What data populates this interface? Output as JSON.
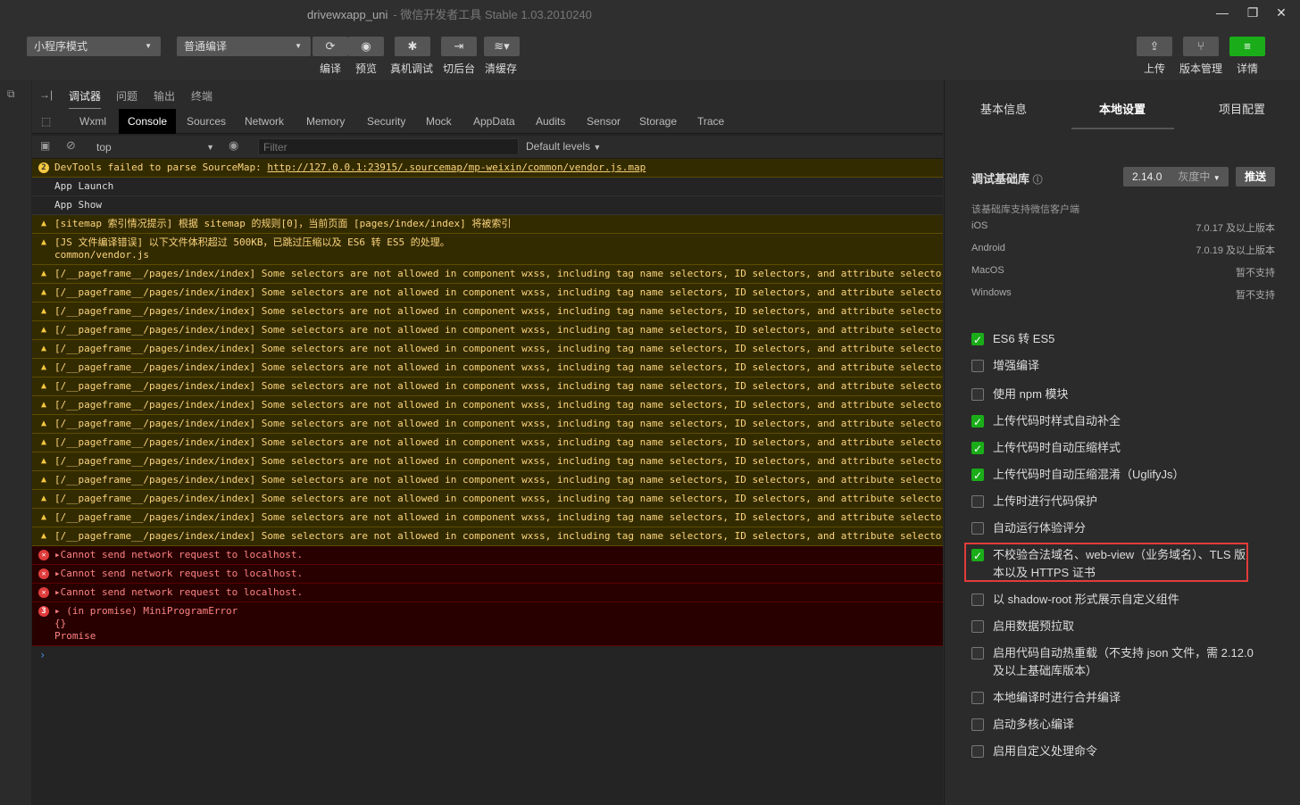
{
  "window": {
    "title": "drivewxapp_uni",
    "subtitle": "- 微信开发者工具 Stable 1.03.2010240",
    "minimize_icon": "minimize-icon",
    "restore_icon": "restore-icon",
    "close_icon": "close-icon"
  },
  "toolbar": {
    "mode_select": "小程序模式",
    "compile_select": "普通编译",
    "buttons": [
      {
        "label": "编译",
        "icon": "refresh-icon"
      },
      {
        "label": "预览",
        "icon": "eye-icon"
      },
      {
        "label": "真机调试",
        "icon": "bug-icon"
      },
      {
        "label": "切后台",
        "icon": "switch-icon"
      },
      {
        "label": "清缓存",
        "icon": "layers-icon"
      }
    ],
    "right_buttons": [
      {
        "label": "上传",
        "icon": "upload-icon"
      },
      {
        "label": "版本管理",
        "icon": "branch-icon"
      },
      {
        "label": "详情",
        "icon": "menu-icon"
      }
    ],
    "accent": "#1aad19"
  },
  "devtools": {
    "top_tabs": [
      "调试器",
      "问题",
      "输出",
      "终端"
    ],
    "panel_tabs": [
      "Wxml",
      "Console",
      "Sources",
      "Network",
      "Memory",
      "Security",
      "Mock",
      "AppData",
      "Audits",
      "Sensor",
      "Storage",
      "Trace"
    ],
    "context": "top",
    "filter_placeholder": "Filter",
    "levels": "Default levels"
  },
  "console": {
    "sourcemap_count": "2",
    "sourcemap_prefix": "DevTools failed to parse SourceMap: ",
    "sourcemap_link": "http://127.0.0.1:23915/.sourcemap/mp-weixin/common/vendor.js.map",
    "app_launch": "App Launch",
    "app_show": "App Show",
    "sitemap_warn": "[sitemap 索引情况提示] 根据 sitemap 的规则[0]，当前页面 [pages/index/index] 将被索引",
    "js_warn_line1": "[JS 文件编译错误] 以下文件体积超过 500KB，已跳过压缩以及 ES6 转 ES5 的处理。",
    "js_warn_line2": "common/vendor.js",
    "selector_warn": "[/__pageframe__/pages/index/index] Some selectors are not allowed in component wxss, including tag name selectors, ID selectors, and attribute selectors.",
    "network_error": "Cannot send network request to localhost.",
    "promise_count": "3",
    "promise_line1": "(in promise) MiniProgramError",
    "promise_line2": "{}",
    "promise_line3": "Promise",
    "prompt": "›"
  },
  "settings": {
    "tabs": [
      "基本信息",
      "本地设置",
      "项目配置"
    ],
    "lib_label": "调试基础库",
    "lib_version": "2.14.0",
    "lib_status": "灰度中",
    "push_button": "推送",
    "support_title": "该基础库支持微信客户端",
    "platforms": [
      {
        "name": "iOS",
        "value": "7.0.17 及以上版本"
      },
      {
        "name": "Android",
        "value": "7.0.19 及以上版本"
      },
      {
        "name": "MacOS",
        "value": "暂不支持"
      },
      {
        "name": "Windows",
        "value": "暂不支持"
      }
    ],
    "options": [
      {
        "label": "ES6 转 ES5",
        "checked": true
      },
      {
        "label": "增强编译",
        "checked": false
      },
      {
        "label": "使用 npm 模块",
        "checked": false
      },
      {
        "label": "上传代码时样式自动补全",
        "checked": true
      },
      {
        "label": "上传代码时自动压缩样式",
        "checked": true
      },
      {
        "label": "上传代码时自动压缩混淆（UglifyJs）",
        "checked": true
      },
      {
        "label": "上传时进行代码保护",
        "checked": false
      },
      {
        "label": "自动运行体验评分",
        "checked": false
      },
      {
        "label": "不校验合法域名、web-view（业务域名）、TLS 版本以及 HTTPS 证书",
        "checked": true
      },
      {
        "label": "以 shadow-root 形式展示自定义组件",
        "checked": false
      },
      {
        "label": "启用数据预拉取",
        "checked": false
      },
      {
        "label": "启用代码自动热重载（不支持 json 文件，需 2.12.0 及以上基础库版本）",
        "checked": false
      },
      {
        "label": "本地编译时进行合并编译",
        "checked": false
      },
      {
        "label": "启动多核心编译",
        "checked": false
      },
      {
        "label": "启用自定义处理命令",
        "checked": false
      }
    ]
  }
}
